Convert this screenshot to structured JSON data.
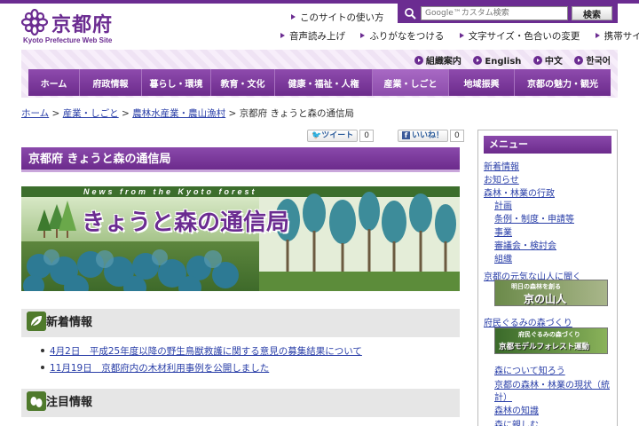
{
  "site": {
    "logo_text": "京都府",
    "logo_sub": "Kyoto Prefecture Web Site",
    "howto": "このサイトの使い方"
  },
  "search": {
    "placeholder": "Google™カスタム検索",
    "button": "検索"
  },
  "utility": [
    "音声読み上げ",
    "ふりがなをつける",
    "文字サイズ・色合いの変更",
    "携帯サイト"
  ],
  "languages": [
    "組織案内",
    "English",
    "中文",
    "한국어"
  ],
  "nav": [
    {
      "label": "ホーム",
      "active": false
    },
    {
      "label": "府政情報",
      "active": false
    },
    {
      "label": "暮らし・環境",
      "active": false
    },
    {
      "label": "教育・文化",
      "active": false
    },
    {
      "label": "健康・福祉・人権",
      "active": false
    },
    {
      "label": "産業・しごと",
      "active": true
    },
    {
      "label": "地域振興",
      "active": false
    },
    {
      "label": "京都の魅力・観光",
      "active": false
    }
  ],
  "breadcrumb": {
    "home": "ホーム",
    "b1": "産業・しごと",
    "b2": "農林水産業・農山漁村",
    "current": "京都府 きょうと森の通信局",
    "sep": ">"
  },
  "social": {
    "tweet": "ツイート",
    "tweet_count": "0",
    "like": "いいね！",
    "like_count": "0"
  },
  "page_title": "京都府 きょうと森の通信局",
  "banner": {
    "tagline": "News from the Kyoto forest",
    "title": "きょうと森の通信局"
  },
  "sections": {
    "news": "新着情報",
    "featured": "注目情報"
  },
  "news_items": [
    "4月2日　平成25年度以降の野生鳥獣救護に関する意見の募集結果について",
    "11月19日　京都府内の木材利用事例を公開しました"
  ],
  "sidebar": {
    "menu_title": "メニュー",
    "links": {
      "l1": "新着情報",
      "l2": "お知らせ",
      "l3": "森林・林業の行政",
      "l3a": "計画",
      "l3b": "条例・制度・申請等",
      "l3c": "事業",
      "l3d": "審議会・検討会",
      "l3e": "組織",
      "l4": "京都の元気な山人に聞く",
      "l5": "府民ぐるみの森づくり",
      "l5a": "森について知ろう",
      "l5b": "京都の森林・林業の現状（統",
      "l5b2": "計）",
      "l5c": "森林の知識",
      "l5d": "森に親しむ"
    },
    "banner1": {
      "top": "明日の森林を創る",
      "main": "京の山人"
    },
    "banner2": {
      "top": "府民ぐるみの森づくり",
      "main": "京都モデルフォレスト運動"
    }
  },
  "colors": {
    "brand_purple": "#6b2c91",
    "link": "#2a3fa8",
    "leaf_green": "#4f7a2c"
  }
}
